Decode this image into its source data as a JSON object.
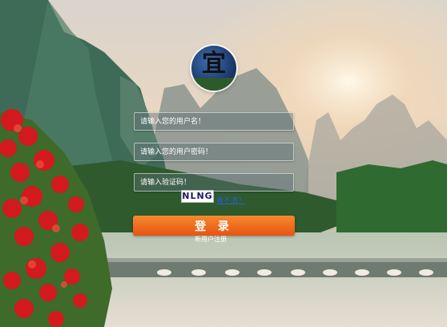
{
  "login": {
    "username_placeholder": "请输入您的用户名！",
    "password_placeholder": "请输入您的用户密码！",
    "captcha_placeholder": "请输入验证码！",
    "captcha_text": "NLNG",
    "captcha_refresh_label": "看不清？",
    "submit_label": "登 录",
    "register_label": "新用户注册"
  },
  "logo": {
    "glyph": "宜"
  },
  "colors": {
    "button_top": "#f58a2e",
    "button_bottom": "#e85312",
    "link": "#2a62c8"
  }
}
